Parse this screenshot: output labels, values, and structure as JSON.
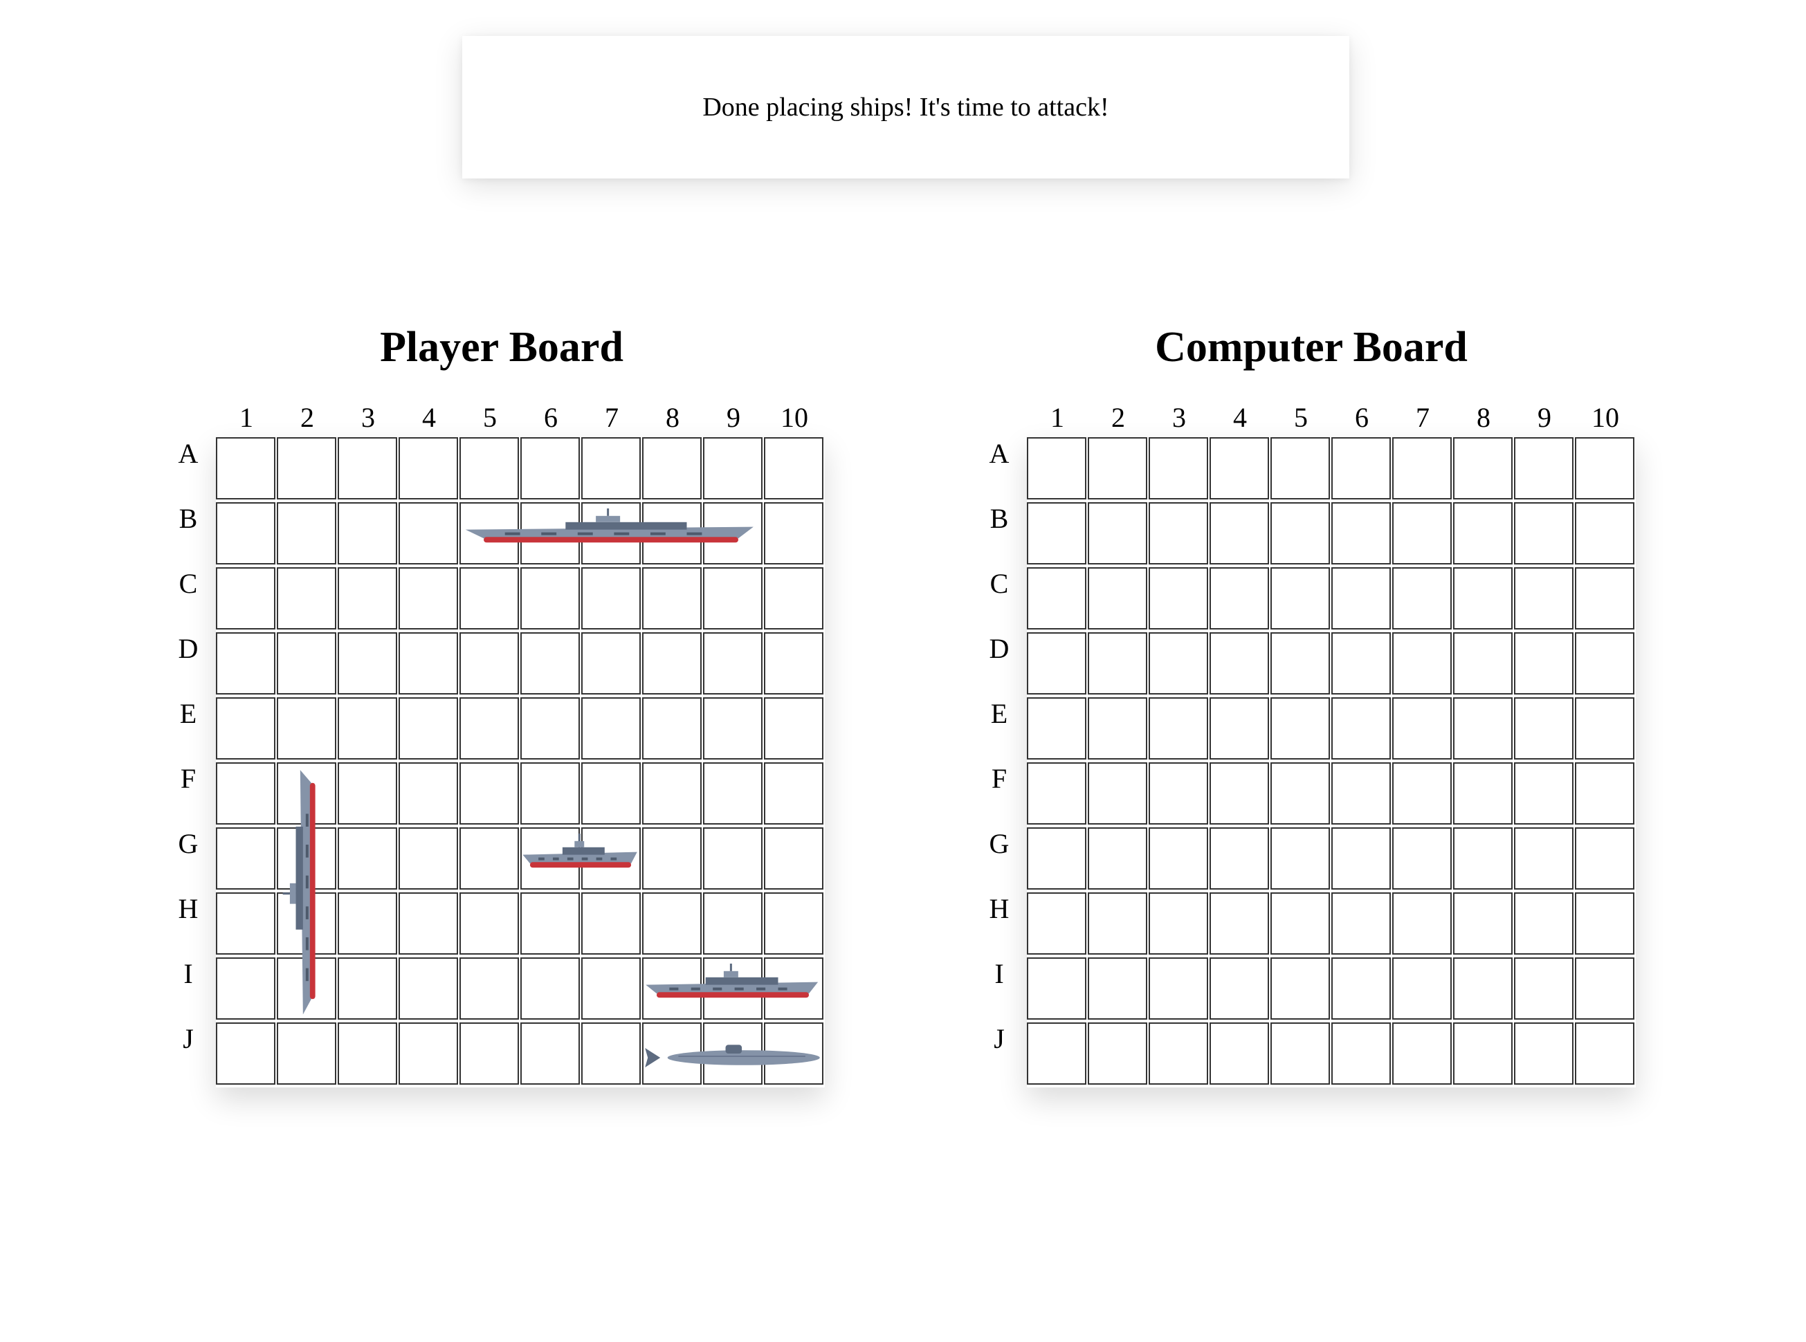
{
  "message": "Done placing ships! It's time to attack!",
  "columns": [
    "1",
    "2",
    "3",
    "4",
    "5",
    "6",
    "7",
    "8",
    "9",
    "10"
  ],
  "rows": [
    "A",
    "B",
    "C",
    "D",
    "E",
    "F",
    "G",
    "H",
    "I",
    "J"
  ],
  "player_board": {
    "title": "Player Board",
    "ships": [
      {
        "name": "carrier",
        "orientation": "horizontal",
        "cells": [
          "B5",
          "B6",
          "B7",
          "B8",
          "B9"
        ]
      },
      {
        "name": "battleship",
        "orientation": "vertical",
        "cells": [
          "F2",
          "G2",
          "H2",
          "I2"
        ]
      },
      {
        "name": "patrol-boat",
        "orientation": "horizontal",
        "cells": [
          "G6",
          "G7"
        ]
      },
      {
        "name": "destroyer",
        "orientation": "horizontal",
        "cells": [
          "I8",
          "I9",
          "I10"
        ]
      },
      {
        "name": "submarine",
        "orientation": "horizontal",
        "cells": [
          "J8",
          "J9",
          "J10"
        ]
      }
    ]
  },
  "computer_board": {
    "title": "Computer Board"
  },
  "colors": {
    "hull": "#8593a8",
    "hull_dark": "#5d6b80",
    "waterline": "#c8343a",
    "cell_border": "#333333"
  }
}
